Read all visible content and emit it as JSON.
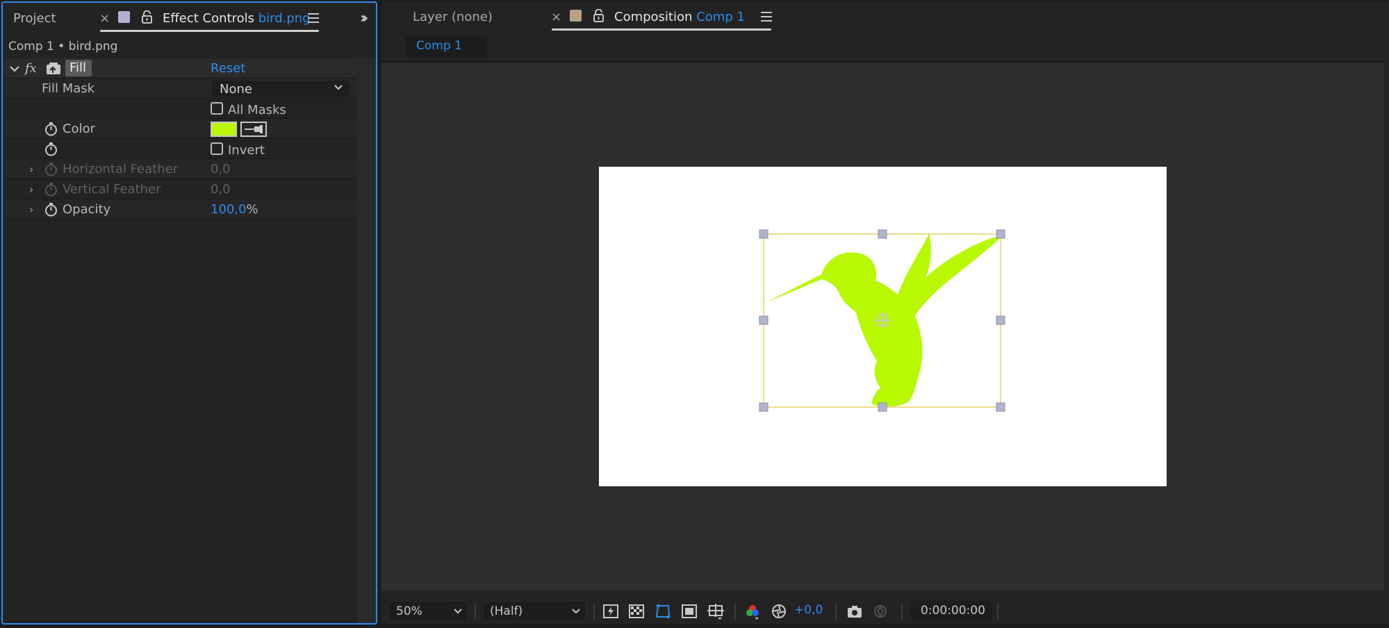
{
  "left_panel": {
    "tabs": {
      "project": "Project",
      "effect_controls_prefix": "Effect Controls",
      "effect_controls_file": "bird.png"
    },
    "breadcrumb": "Comp 1 • bird.png",
    "effect": {
      "fx_label": "fx",
      "name": "Fill",
      "reset": "Reset"
    },
    "properties": {
      "fill_mask_label": "Fill Mask",
      "fill_mask_value": "None",
      "all_masks_label": "All Masks",
      "color_label": "Color",
      "color_value": "#b8f800",
      "invert_label": "Invert",
      "horizontal_feather_label": "Horizontal Feather",
      "horizontal_feather_value": "0,0",
      "vertical_feather_label": "Vertical Feather",
      "vertical_feather_value": "0,0",
      "opacity_label": "Opacity",
      "opacity_value": "100,0",
      "opacity_unit": "%"
    }
  },
  "right_panel": {
    "tabs": {
      "layer": "Layer (none)",
      "composition_prefix": "Composition",
      "composition_name": "Comp 1"
    },
    "comp_subtab": "Comp 1",
    "bottom_bar": {
      "zoom": "50%",
      "resolution": "(Half)",
      "exposure": "+0,0",
      "timecode": "0:00:00:00"
    }
  },
  "colors": {
    "accent": "#2d8ceb",
    "effect_controls_swatch": "#b4b0d2",
    "composition_swatch": "#b8a283",
    "fill_color": "#b8f800",
    "bounding_box": "#ecdc8a",
    "handle": "#b0b4cc"
  },
  "icons": [
    "close-icon",
    "lock-icon",
    "panel-menu-icon",
    "double-chevron-icon",
    "stopwatch-icon",
    "fx-icon",
    "effect-toggle-icon",
    "eyedropper-icon",
    "chevron-down-icon",
    "fast-previews-icon",
    "transparency-grid-icon",
    "mask-path-icon",
    "region-of-interest-icon",
    "guides-icon",
    "channel-icon",
    "color-management-icon",
    "snapshot-icon",
    "show-snapshot-icon",
    "anchor-point-icon"
  ]
}
